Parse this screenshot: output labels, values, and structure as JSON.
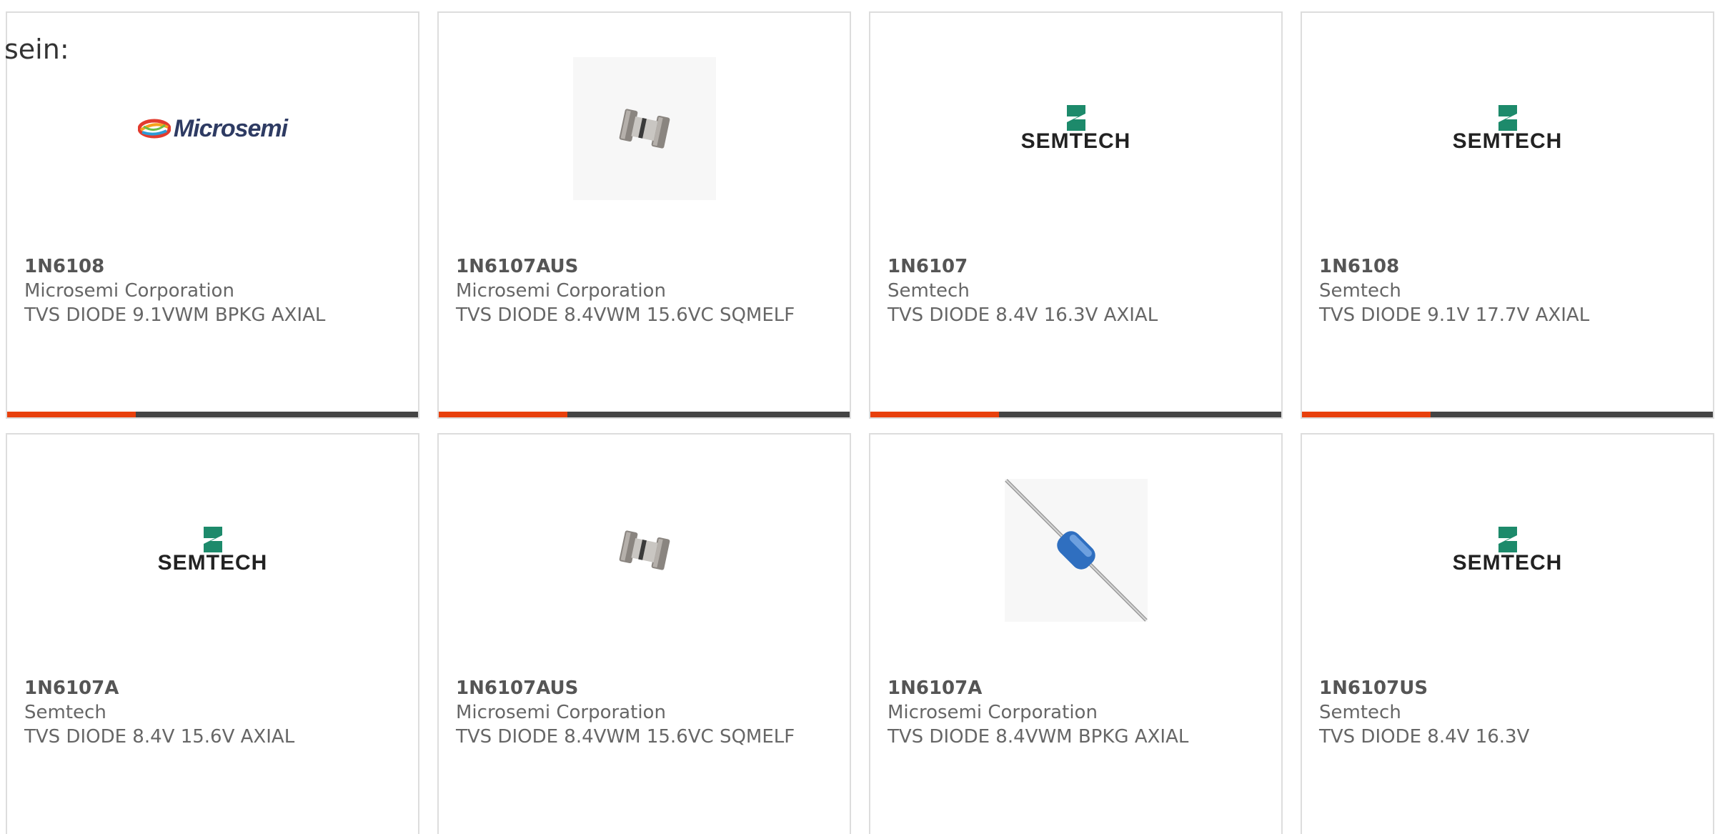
{
  "intro_text": "sein:",
  "brand_colors": {
    "accent": "#e8400c",
    "bar": "#444444",
    "text": "#666666",
    "border": "#dddddd"
  },
  "products": [
    {
      "part": "1N6108",
      "manufacturer": "Microsemi Corporation",
      "description": "TVS DIODE 9.1VWM BPKG AXIAL",
      "image": "microsemi-logo",
      "logo_text": "Microsemi",
      "has_bar": true
    },
    {
      "part": "1N6107AUS",
      "manufacturer": "Microsemi Corporation",
      "description": "TVS DIODE 8.4VWM 15.6VC SQMELF",
      "image": "melf-diode-photo",
      "has_bar": true
    },
    {
      "part": "1N6107",
      "manufacturer": "Semtech",
      "description": "TVS DIODE 8.4V 16.3V AXIAL",
      "image": "semtech-logo",
      "logo_text": "SEMTECH",
      "has_bar": true
    },
    {
      "part": "1N6108",
      "manufacturer": "Semtech",
      "description": "TVS DIODE 9.1V 17.7V AXIAL",
      "image": "semtech-logo",
      "logo_text": "SEMTECH",
      "has_bar": true
    },
    {
      "part": "1N6107A",
      "manufacturer": "Semtech",
      "description": "TVS DIODE 8.4V 15.6V AXIAL",
      "image": "semtech-logo",
      "logo_text": "SEMTECH",
      "has_bar": false
    },
    {
      "part": "1N6107AUS",
      "manufacturer": "Microsemi Corporation",
      "description": "TVS DIODE 8.4VWM 15.6VC SQMELF",
      "image": "melf-diode-photo",
      "has_bar": false
    },
    {
      "part": "1N6107A",
      "manufacturer": "Microsemi Corporation",
      "description": "TVS DIODE 8.4VWM BPKG AXIAL",
      "image": "axial-diode-photo",
      "has_bar": false
    },
    {
      "part": "1N6107US",
      "manufacturer": "Semtech",
      "description": "TVS DIODE 8.4V 16.3V",
      "image": "semtech-logo",
      "logo_text": "SEMTECH",
      "has_bar": false
    }
  ]
}
